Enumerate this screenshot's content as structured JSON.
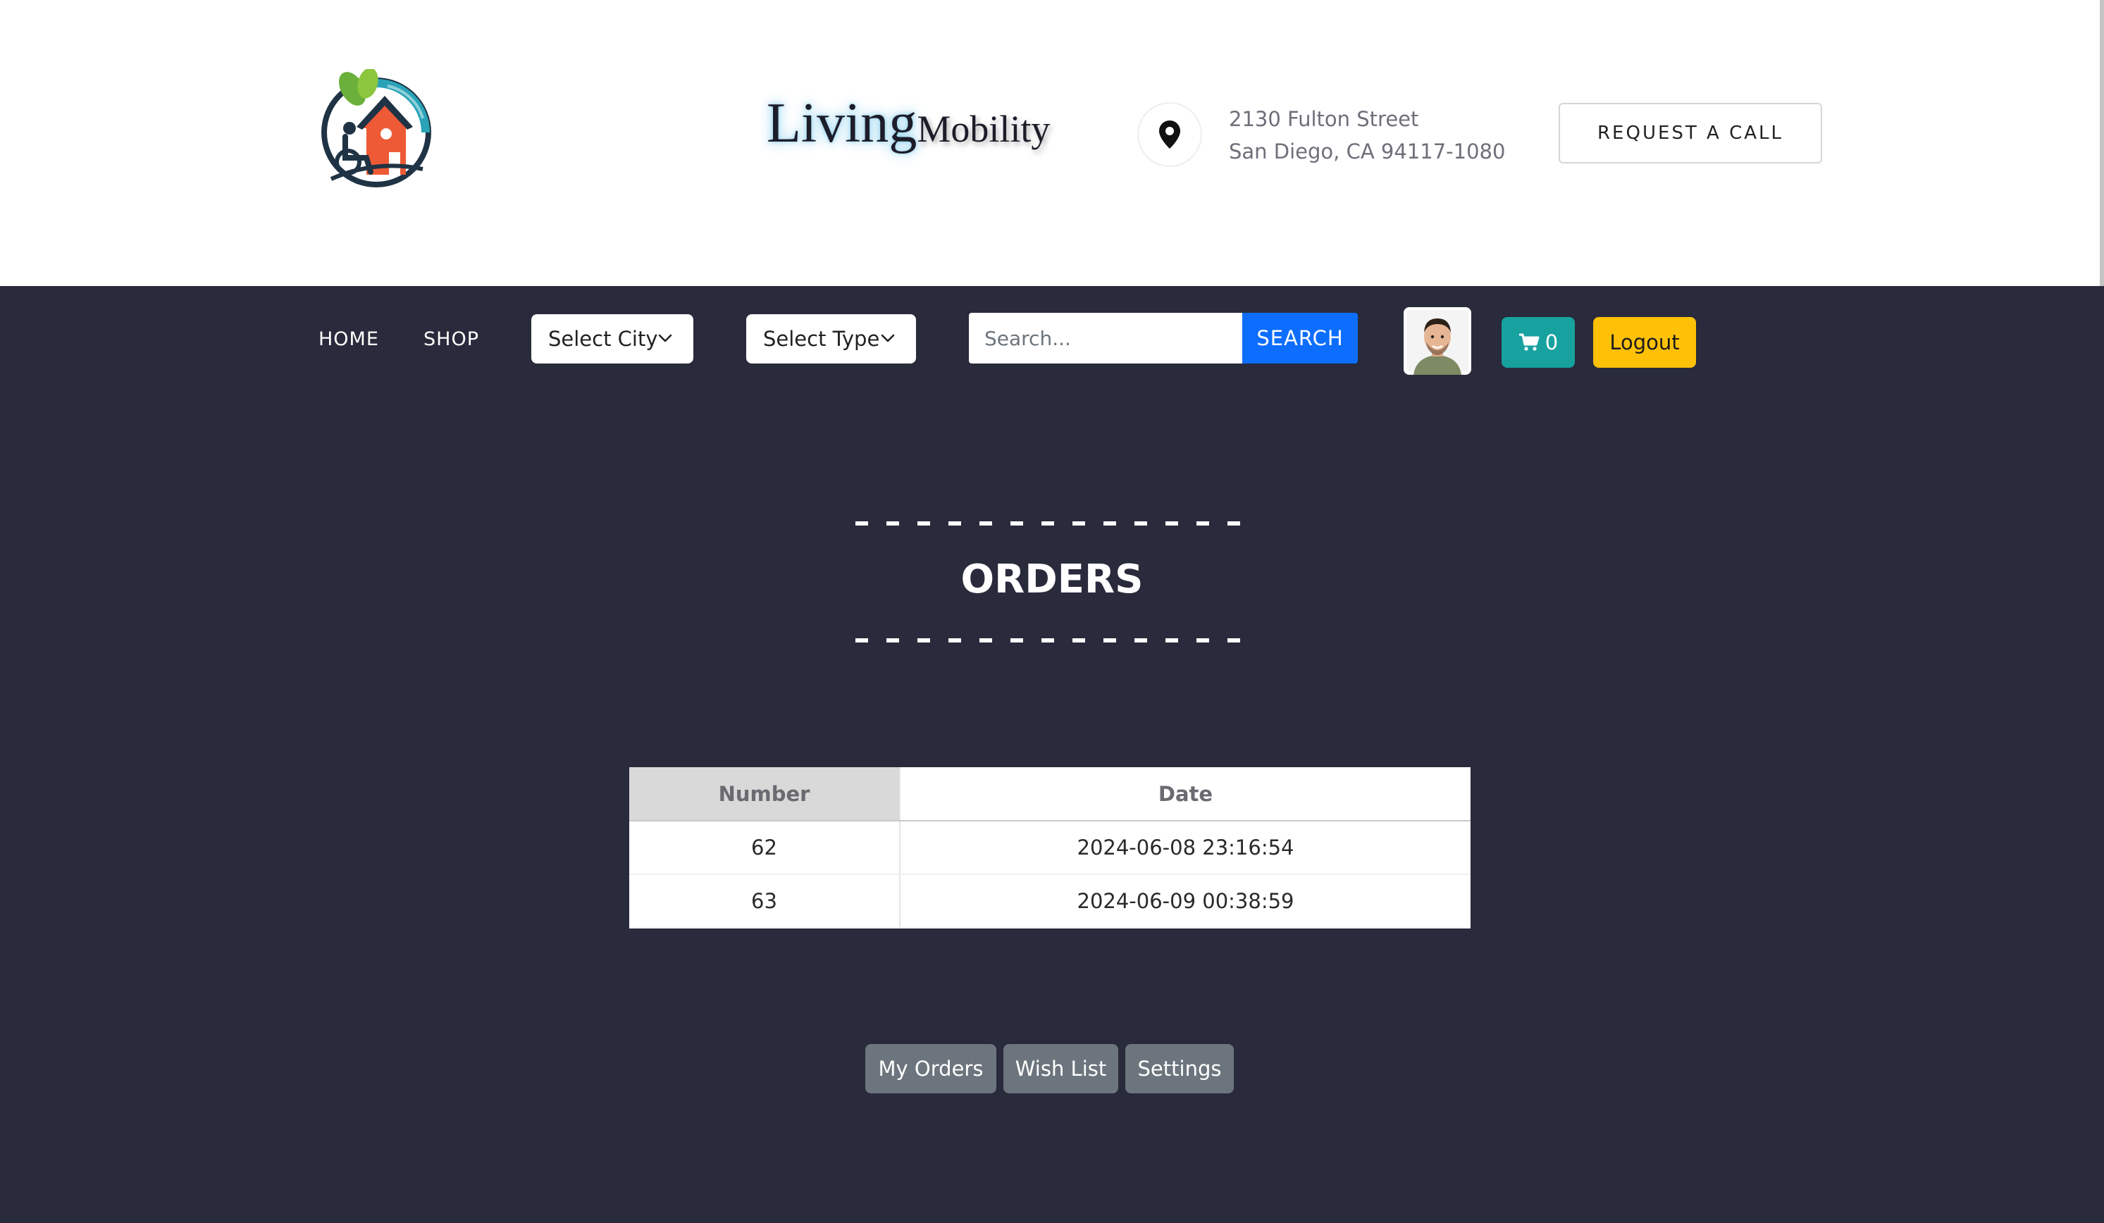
{
  "header": {
    "brand_living": "Living",
    "brand_mobility": "Mobility",
    "address_line1": "2130 Fulton Street",
    "address_line2": "San Diego, CA 94117-1080",
    "request_call_label": "REQUEST A CALL"
  },
  "nav": {
    "home_label": "HOME",
    "shop_label": "SHOP",
    "select_city_value": "Select City",
    "select_type_value": "Select Type",
    "search_placeholder": "Search...",
    "search_button_label": "SEARCH",
    "cart_count": "0",
    "logout_label": "Logout"
  },
  "page": {
    "title": "ORDERS"
  },
  "orders_table": {
    "headers": [
      "Number",
      "Date"
    ],
    "rows": [
      {
        "number": "62",
        "date": "2024-06-08 23:16:54"
      },
      {
        "number": "63",
        "date": "2024-06-09 00:38:59"
      }
    ]
  },
  "account_tabs": {
    "my_orders": "My Orders",
    "wish_list": "Wish List",
    "settings": "Settings"
  },
  "colors": {
    "main_background": "#292a3b",
    "search_button": "#0d6efd",
    "cart_button": "#17a2a0",
    "logout_button": "#ffc107",
    "tab_button": "#6c757d",
    "logo_house": "#ee5a36",
    "logo_leaf": "#6bb03a",
    "logo_ring": "#2aa3b8"
  },
  "icons": {
    "location": "map-pin-icon",
    "cart": "shopping-cart-icon",
    "dropdown": "chevron-down-icon"
  }
}
